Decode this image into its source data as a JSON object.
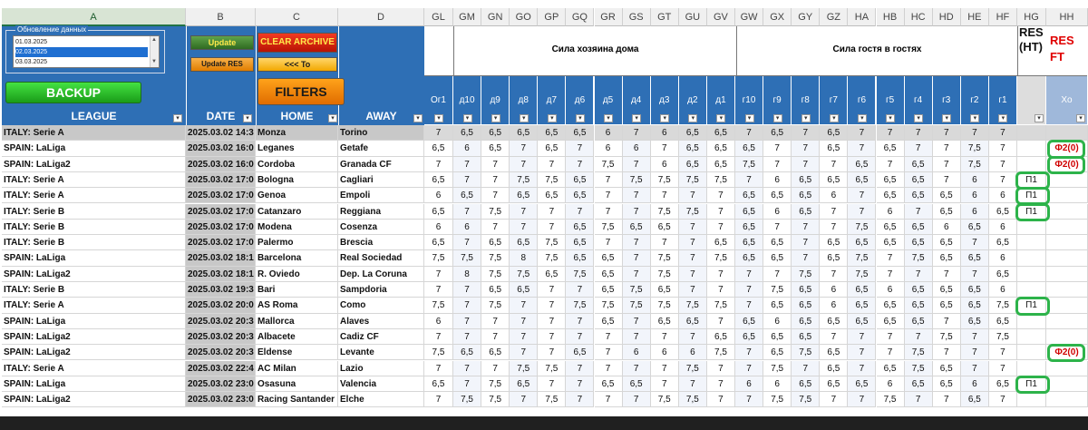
{
  "sheet": {
    "col_letters_left": [
      "A",
      "B",
      "C",
      "D"
    ],
    "col_letters_right": [
      "GL",
      "GM",
      "GN",
      "GO",
      "GP",
      "GQ",
      "GR",
      "GS",
      "GT",
      "GU",
      "GV",
      "GW",
      "GX",
      "GY",
      "GZ",
      "HA",
      "HB",
      "HC",
      "HD",
      "HE",
      "HF",
      "HG",
      "HH"
    ]
  },
  "controls": {
    "update_group_label": "Обновление данных",
    "dates": [
      "01.03.2025",
      "02.03.2025",
      "03.03.2025"
    ],
    "update_label": "Update",
    "update_res_label": "Update RES",
    "clear_archive_label": "CLEAR ARCHIVE",
    "to_label": "<<< To",
    "backup_label": "BACKUP",
    "filters_label": "FILTERS"
  },
  "headers": {
    "league": "LEAGUE",
    "date": "DATE",
    "home": "HOME",
    "away": "AWAY",
    "home_strength": "Сила хозяина дома",
    "away_strength": "Сила гостя в гостях",
    "res_ht": "RES (HT)",
    "res_ft": "RES FT",
    "xo": "Xo",
    "sub_cols": [
      "Ог1",
      "д10",
      "д9",
      "д8",
      "д7",
      "д6",
      "д5",
      "д4",
      "д3",
      "д2",
      "д1",
      "г10",
      "г9",
      "г8",
      "г7",
      "г6",
      "г5",
      "г4",
      "г3",
      "г2",
      "г1"
    ]
  },
  "rows": [
    {
      "league": "ITALY: Serie A",
      "date": "2025.03.02 14:3",
      "home": "Monza",
      "away": "Torino",
      "vals": [
        "7",
        "6,5",
        "6,5",
        "6,5",
        "6,5",
        "6,5",
        "6",
        "7",
        "6",
        "6,5",
        "6,5",
        "7",
        "6,5",
        "7",
        "6,5",
        "7",
        "7",
        "7",
        "7",
        "7",
        "7"
      ],
      "ht": "",
      "ft": ""
    },
    {
      "league": "SPAIN: LaLiga",
      "date": "2025.03.02 16:0",
      "home": "Leganes",
      "away": "Getafe",
      "vals": [
        "6,5",
        "6",
        "6,5",
        "7",
        "6,5",
        "7",
        "6",
        "6",
        "7",
        "6,5",
        "6,5",
        "6,5",
        "7",
        "7",
        "6,5",
        "7",
        "6,5",
        "7",
        "7",
        "7,5",
        "7"
      ],
      "ht": "",
      "ft": "Ф2(0)"
    },
    {
      "league": "SPAIN: LaLiga2",
      "date": "2025.03.02 16:0",
      "home": "Cordoba",
      "away": "Granada CF",
      "vals": [
        "7",
        "7",
        "7",
        "7",
        "7",
        "7",
        "7,5",
        "7",
        "6",
        "6,5",
        "6,5",
        "7,5",
        "7",
        "7",
        "7",
        "6,5",
        "7",
        "6,5",
        "7",
        "7,5",
        "7"
      ],
      "ht": "",
      "ft": "Ф2(0)"
    },
    {
      "league": "ITALY: Serie A",
      "date": "2025.03.02 17:0",
      "home": "Bologna",
      "away": "Cagliari",
      "vals": [
        "6,5",
        "7",
        "7",
        "7,5",
        "7,5",
        "6,5",
        "7",
        "7,5",
        "7,5",
        "7,5",
        "7,5",
        "7",
        "6",
        "6,5",
        "6,5",
        "6,5",
        "6,5",
        "6,5",
        "7",
        "6",
        "7"
      ],
      "ht": "П1",
      "ft": ""
    },
    {
      "league": "ITALY: Serie A",
      "date": "2025.03.02 17:0",
      "home": "Genoa",
      "away": "Empoli",
      "vals": [
        "6",
        "6,5",
        "7",
        "6,5",
        "6,5",
        "6,5",
        "7",
        "7",
        "7",
        "7",
        "7",
        "6,5",
        "6,5",
        "6,5",
        "6",
        "7",
        "6,5",
        "6,5",
        "6,5",
        "6",
        "6"
      ],
      "ht": "П1",
      "ft": ""
    },
    {
      "league": "ITALY: Serie B",
      "date": "2025.03.02 17:0",
      "home": "Catanzaro",
      "away": "Reggiana",
      "vals": [
        "6,5",
        "7",
        "7,5",
        "7",
        "7",
        "7",
        "7",
        "7",
        "7,5",
        "7,5",
        "7",
        "6,5",
        "6",
        "6,5",
        "7",
        "7",
        "6",
        "7",
        "6,5",
        "6",
        "6,5"
      ],
      "ht": "П1",
      "ft": ""
    },
    {
      "league": "ITALY: Serie B",
      "date": "2025.03.02 17:0",
      "home": "Modena",
      "away": "Cosenza",
      "vals": [
        "6",
        "6",
        "7",
        "7",
        "7",
        "6,5",
        "7,5",
        "6,5",
        "6,5",
        "7",
        "7",
        "6,5",
        "7",
        "7",
        "7",
        "7,5",
        "6,5",
        "6,5",
        "6",
        "6,5",
        "6"
      ],
      "ht": "",
      "ft": ""
    },
    {
      "league": "ITALY: Serie B",
      "date": "2025.03.02 17:0",
      "home": "Palermo",
      "away": "Brescia",
      "vals": [
        "6,5",
        "7",
        "6,5",
        "6,5",
        "7,5",
        "6,5",
        "7",
        "7",
        "7",
        "7",
        "6,5",
        "6,5",
        "6,5",
        "7",
        "6,5",
        "6,5",
        "6,5",
        "6,5",
        "6,5",
        "7",
        "6,5"
      ],
      "ht": "",
      "ft": ""
    },
    {
      "league": "SPAIN: LaLiga",
      "date": "2025.03.02 18:1",
      "home": "Barcelona",
      "away": "Real Sociedad",
      "vals": [
        "7,5",
        "7,5",
        "7,5",
        "8",
        "7,5",
        "6,5",
        "6,5",
        "7",
        "7,5",
        "7",
        "7,5",
        "6,5",
        "6,5",
        "7",
        "6,5",
        "7,5",
        "7",
        "7,5",
        "6,5",
        "6,5",
        "6"
      ],
      "ht": "",
      "ft": ""
    },
    {
      "league": "SPAIN: LaLiga2",
      "date": "2025.03.02 18:1",
      "home": "R. Oviedo",
      "away": "Dep. La Coruna",
      "vals": [
        "7",
        "8",
        "7,5",
        "7,5",
        "6,5",
        "7,5",
        "6,5",
        "7",
        "7,5",
        "7",
        "7",
        "7",
        "7",
        "7,5",
        "7",
        "7,5",
        "7",
        "7",
        "7",
        "7",
        "6,5"
      ],
      "ht": "",
      "ft": ""
    },
    {
      "league": "ITALY: Serie B",
      "date": "2025.03.02 19:3",
      "home": "Bari",
      "away": "Sampdoria",
      "vals": [
        "7",
        "7",
        "6,5",
        "6,5",
        "7",
        "7",
        "6,5",
        "7,5",
        "6,5",
        "7",
        "7",
        "7",
        "7,5",
        "6,5",
        "6",
        "6,5",
        "6",
        "6,5",
        "6,5",
        "6,5",
        "6"
      ],
      "ht": "",
      "ft": ""
    },
    {
      "league": "ITALY: Serie A",
      "date": "2025.03.02 20:0",
      "home": "AS Roma",
      "away": "Como",
      "vals": [
        "7,5",
        "7",
        "7,5",
        "7",
        "7",
        "7,5",
        "7,5",
        "7,5",
        "7,5",
        "7,5",
        "7,5",
        "7",
        "6,5",
        "6,5",
        "6",
        "6,5",
        "6,5",
        "6,5",
        "6,5",
        "6,5",
        "7,5"
      ],
      "ht": "П1",
      "ft": ""
    },
    {
      "league": "SPAIN: LaLiga",
      "date": "2025.03.02 20:3",
      "home": "Mallorca",
      "away": "Alaves",
      "vals": [
        "6",
        "7",
        "7",
        "7",
        "7",
        "7",
        "6,5",
        "7",
        "6,5",
        "6,5",
        "7",
        "6,5",
        "6",
        "6,5",
        "6,5",
        "6,5",
        "6,5",
        "6,5",
        "7",
        "6,5",
        "6,5"
      ],
      "ht": "",
      "ft": ""
    },
    {
      "league": "SPAIN: LaLiga2",
      "date": "2025.03.02 20:3",
      "home": "Albacete",
      "away": "Cadiz CF",
      "vals": [
        "7",
        "7",
        "7",
        "7",
        "7",
        "7",
        "7",
        "7",
        "7",
        "7",
        "6,5",
        "6,5",
        "6,5",
        "6,5",
        "7",
        "7",
        "7",
        "7",
        "7,5",
        "7",
        "7,5"
      ],
      "ht": "",
      "ft": ""
    },
    {
      "league": "SPAIN: LaLiga2",
      "date": "2025.03.02 20:3",
      "home": "Eldense",
      "away": "Levante",
      "vals": [
        "7,5",
        "6,5",
        "6,5",
        "7",
        "7",
        "6,5",
        "7",
        "6",
        "6",
        "6",
        "7,5",
        "7",
        "6,5",
        "7,5",
        "6,5",
        "7",
        "7",
        "7,5",
        "7",
        "7",
        "7"
      ],
      "ht": "",
      "ft": "Ф2(0)"
    },
    {
      "league": "ITALY: Serie A",
      "date": "2025.03.02 22:4",
      "home": "AC Milan",
      "away": "Lazio",
      "vals": [
        "7",
        "7",
        "7",
        "7,5",
        "7,5",
        "7",
        "7",
        "7",
        "7",
        "7,5",
        "7",
        "7",
        "7,5",
        "7",
        "6,5",
        "7",
        "6,5",
        "7,5",
        "6,5",
        "7",
        "7"
      ],
      "ht": "",
      "ft": ""
    },
    {
      "league": "SPAIN: LaLiga",
      "date": "2025.03.02 23:0",
      "home": "Osasuna",
      "away": "Valencia",
      "vals": [
        "6,5",
        "7",
        "7,5",
        "6,5",
        "7",
        "7",
        "6,5",
        "6,5",
        "7",
        "7",
        "7",
        "6",
        "6",
        "6,5",
        "6,5",
        "6,5",
        "6",
        "6,5",
        "6,5",
        "6",
        "6,5"
      ],
      "ht": "П1",
      "ft": ""
    },
    {
      "league": "SPAIN: LaLiga2",
      "date": "2025.03.02 23:0",
      "home": "Racing Santander",
      "away": "Elche",
      "vals": [
        "7",
        "7,5",
        "7,5",
        "7",
        "7,5",
        "7",
        "7",
        "7",
        "7,5",
        "7,5",
        "7",
        "7",
        "7,5",
        "7,5",
        "7",
        "7",
        "7,5",
        "7",
        "7",
        "6,5",
        "7"
      ],
      "ht": "",
      "ft": ""
    }
  ]
}
